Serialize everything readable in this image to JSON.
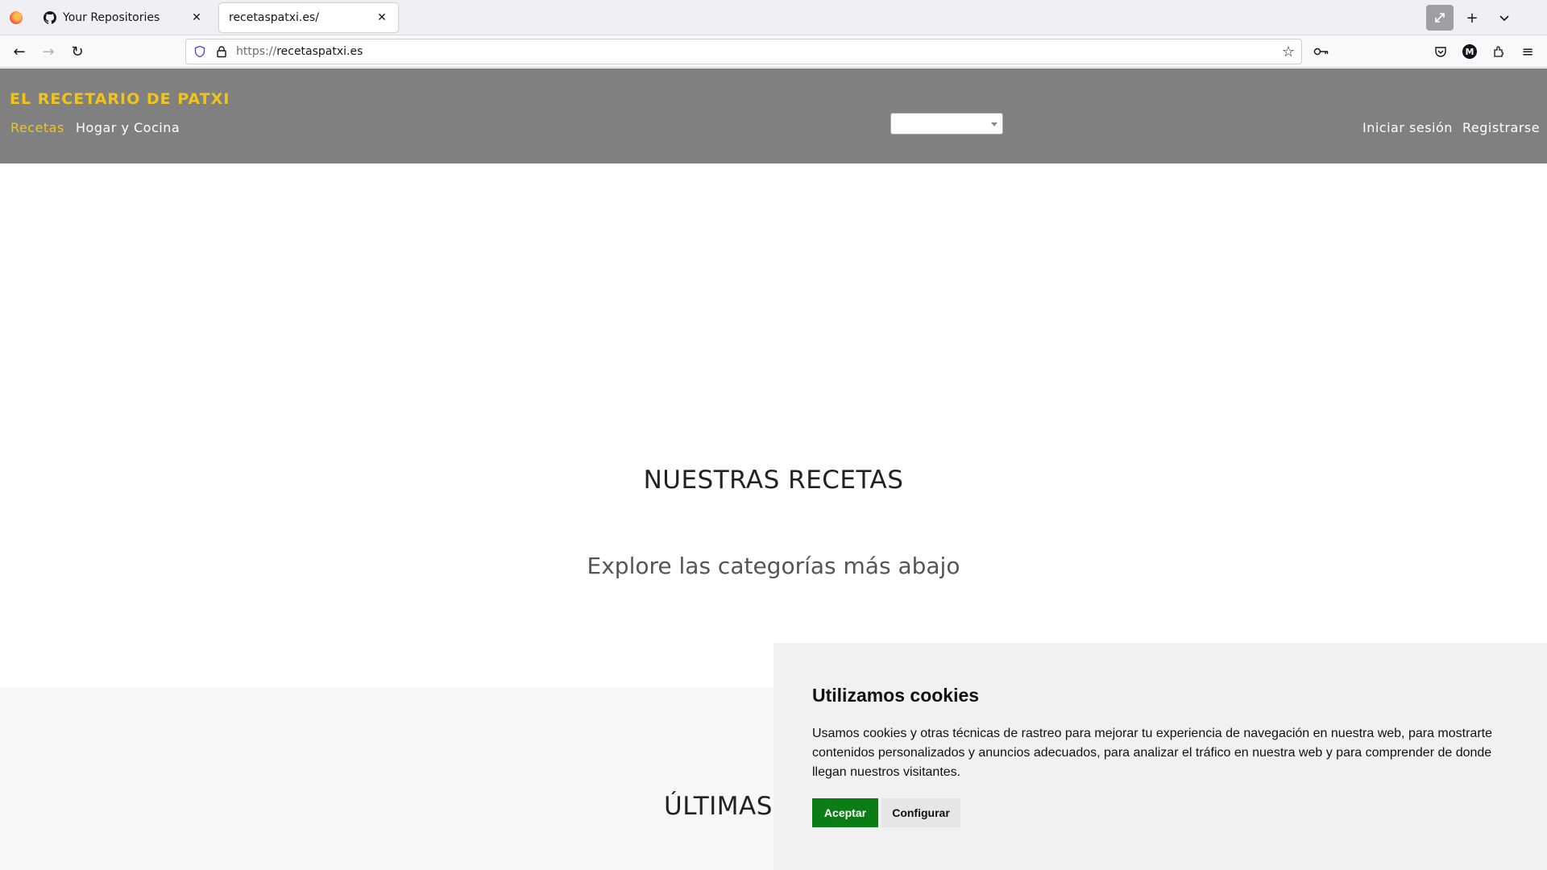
{
  "browser": {
    "tabs": [
      {
        "title": "Your Repositories",
        "icon": "github-icon",
        "active": false
      },
      {
        "title": "recetaspatxi.es/",
        "icon": "",
        "active": true
      }
    ],
    "url_scheme": "https://",
    "url_host": "recetaspatxi.es"
  },
  "site": {
    "brand": "EL RECETARIO DE PATXI",
    "nav": [
      "Recetas",
      "Hogar y Cocina"
    ],
    "language_select_value": "",
    "auth": {
      "login": "Iniciar sesión",
      "register": "Registrarse"
    },
    "colors": {
      "header_bg": "#808080",
      "brand": "#f0c419",
      "accent": "#f0c419"
    }
  },
  "main": {
    "title": "NUESTRAS RECETAS",
    "subtitle": "Explore las categorías más abajo",
    "latest_title": "ÚLTIMAS"
  },
  "cookies": {
    "title": "Utilizamos cookies",
    "text": "Usamos cookies y otras técnicas de rastreo para mejorar tu experiencia de navegación en nuestra web, para mostrarte contenidos personalizados y anuncios adecuados, para analizar el tráfico en nuestra web y para comprender de donde llegan nuestros visitantes.",
    "accept": "Aceptar",
    "configure": "Configurar",
    "accept_color": "#0a7d14"
  }
}
